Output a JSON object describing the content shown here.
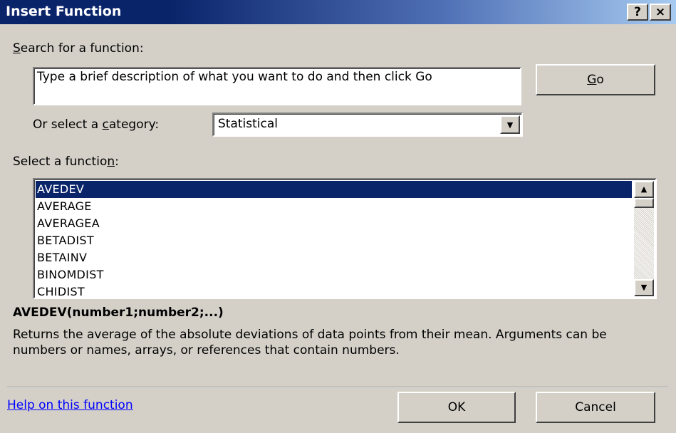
{
  "window": {
    "title": "Insert Function",
    "help_button": "?",
    "close_button": "×"
  },
  "search": {
    "label": "earch for a function:",
    "label_accel": "S",
    "value": "Type a brief description of what you want to do and then click Go",
    "go_label_accel": "G",
    "go_label": "o"
  },
  "category": {
    "label_prefix": "Or select a ",
    "label_accel": "c",
    "label_suffix": "ategory:",
    "selected": "Statistical"
  },
  "functions": {
    "label_prefix": "Select a functio",
    "label_accel": "n",
    "label_suffix": ":",
    "items": [
      "AVEDEV",
      "AVERAGE",
      "AVERAGEA",
      "BETADIST",
      "BETAINV",
      "BINOMDIST",
      "CHIDIST"
    ],
    "selected_index": 0
  },
  "details": {
    "signature": "AVEDEV(number1;number2;...)",
    "description": "Returns the average of the absolute deviations of data points from their mean. Arguments can be numbers or names, arrays, or references that contain numbers."
  },
  "footer": {
    "help_link": "Help on this function",
    "ok_label": "OK",
    "cancel_label": "Cancel"
  },
  "icons": {
    "scroll_up": "up-arrow-icon",
    "scroll_down": "down-arrow-icon",
    "dropdown": "down-arrow-icon"
  },
  "colors": {
    "title_bar": "#0a246a",
    "selection": "#0a246a",
    "dialog_bg": "#d4d0c8",
    "link": "#0000ff"
  }
}
